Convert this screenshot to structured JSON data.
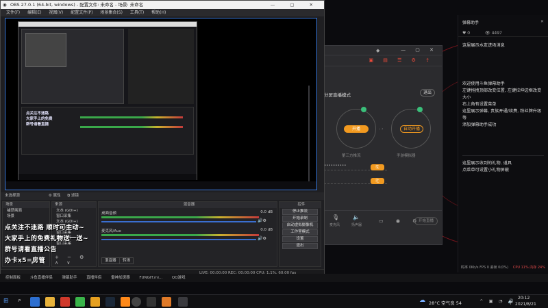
{
  "obs": {
    "title": "OBS 27.0.1 (64-bit, windows) - 配置文件: 未命名 - 场景: 未命名",
    "menu": [
      "文件(F)",
      "编辑(E)",
      "视图(V)",
      "配置文件(P)",
      "场景集合(S)",
      "工具(T)",
      "帮助(H)"
    ],
    "transitions_title": "未选择源",
    "properties_label": "属性",
    "filters_label": "滤镜",
    "scenes_header": "场景",
    "sources_header": "来源",
    "mixer_header": "混音器",
    "controls_header": "控件",
    "scenes": [
      "捕获画面",
      "场景"
    ],
    "sources": [
      "文本 (GDI+)",
      "窗口采集",
      "文本 (GDI+)",
      "文本 (GDI+)",
      "窗口采集",
      "窗口采集",
      "窗口采集"
    ],
    "mixer": [
      {
        "name": "桌面音频",
        "level": "0.0 dB"
      },
      {
        "name": "麦克风/Aux",
        "level": "0.0 dB"
      }
    ],
    "controls": [
      "停止推流",
      "开始录制",
      "启动虚拟摄像机",
      "工作室模式",
      "设置",
      "退出"
    ],
    "mixer_tabs": [
      "混音器",
      "转场"
    ],
    "status": "LIVE: 00:00:00   REC: 00:00:00   CPU: 1.1%, 60.00 fps"
  },
  "overlay_text": {
    "line1": "点关注不迷路 顺时可主动~",
    "line2": "大家手上的免费礼物送一送~",
    "line3": "群号请看直播公告",
    "line4": "办卡x5=房管"
  },
  "tool": {
    "mode_label": "分屏直播模式",
    "exit_label": "退出",
    "left_circle": "开播",
    "right_circle": "自动开播",
    "left_caption": "第三方推流",
    "right_caption": "手游模拟器",
    "start_label": "开始直播",
    "footer_items": [
      "麦克风",
      "扬声器"
    ]
  },
  "chat": {
    "header": "弹幕助手",
    "viewer_count": "4497",
    "lines": [
      "这里展示水友进场消息",
      "欢迎使用斗鱼弹幕助手",
      "左键拖拽顶部改变位置, 左键拉伸边框改变大小",
      "右上角有设置菜单",
      "这里展示弹幕, 贵族开通/续费, 粉丝牌升级等",
      "添加弹幕助手成功",
      "这里展示收到的礼物, 道具",
      "点菜单可设置小礼物屏蔽"
    ],
    "footer_left": "码率 0Kb/s  FPS 0  丢帧 0(0%)",
    "footer_right": "CPU 11%  内存 24%"
  },
  "strip_items": [
    "控制面板",
    "斗鱼直播伴侣",
    "弹幕助手",
    "直播伴侣",
    "雷神加速器",
    "FUNGIT.mi...",
    "QQ游戏"
  ],
  "taskbar": {
    "weather": "28°C  空气良 54",
    "time": "20:12",
    "date": "2021/8/21",
    "lang": "中"
  },
  "colors": {
    "accent_orange": "#f29a20",
    "selection_blue": "#3a7be0",
    "ring_red": "#c81e28"
  }
}
